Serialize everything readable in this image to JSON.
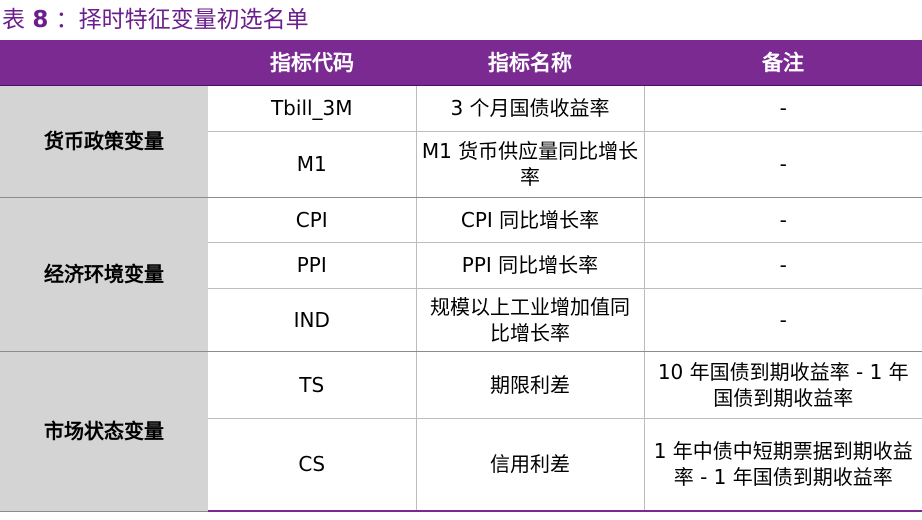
{
  "caption": {
    "prefix": "表",
    "number": "8",
    "text": "：择时特征变量初选名单"
  },
  "table": {
    "headers": [
      "",
      "指标代码",
      "指标名称",
      "备注"
    ],
    "groups": [
      {
        "name": "货币政策变量",
        "rows": [
          {
            "code": "Tbill_3M",
            "name": "3 个月国债收益率",
            "note": "-"
          },
          {
            "code": "M1",
            "name": "M1 货币供应量同比增长率",
            "note": "-"
          }
        ]
      },
      {
        "name": "经济环境变量",
        "rows": [
          {
            "code": "CPI",
            "name": "CPI 同比增长率",
            "note": "-"
          },
          {
            "code": "PPI",
            "name": "PPI 同比增长率",
            "note": "-"
          },
          {
            "code": "IND",
            "name": "规模以上工业增加值同比增长率",
            "note": "-"
          }
        ]
      },
      {
        "name": "市场状态变量",
        "rows": [
          {
            "code": "TS",
            "name": "期限利差",
            "note": "10 年国债到期收益率 - 1 年国债到期收益率"
          },
          {
            "code": "CS",
            "name": "信用利差",
            "note": "1 年中债中短期票据到期收益率 - 1 年国债到期收益率"
          }
        ]
      }
    ]
  },
  "colors": {
    "caption": "#6b1f8c",
    "header_bg": "#7a2a91",
    "group_bg": "#d4d4d4"
  }
}
